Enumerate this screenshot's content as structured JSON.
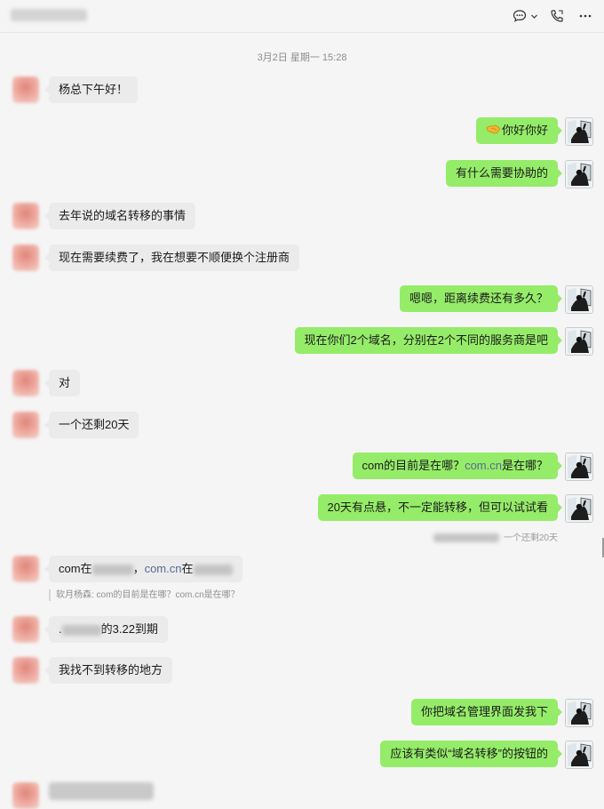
{
  "header": {
    "icons": [
      "chat-bubble-icon",
      "chevron-down-icon",
      "phone-icon",
      "more-icon"
    ]
  },
  "timestamp": "3月2日 星期一 15:28",
  "messages": [
    {
      "dir": "in",
      "text": "杨总下午好！"
    },
    {
      "dir": "out",
      "text": "你好你好",
      "emoji": "handshake-icon"
    },
    {
      "dir": "out",
      "text": "有什么需要协助的"
    },
    {
      "dir": "in",
      "text": "去年说的域名转移的事情"
    },
    {
      "dir": "in",
      "text": "现在需要续费了，我在想要不顺便换个注册商"
    },
    {
      "dir": "out",
      "text": "嗯嗯，距离续费还有多久？"
    },
    {
      "dir": "out",
      "text": "现在你们2个域名，分别在2个不同的服务商是吧"
    },
    {
      "dir": "in",
      "text": "对"
    },
    {
      "dir": "in",
      "text": "一个还剩20天"
    },
    {
      "dir": "out",
      "text_a": "com的目前是在哪？",
      "link": "com.cn",
      "text_b": "是在哪？"
    },
    {
      "dir": "out",
      "text": "20天有点悬，不一定能转移，但可以试试看",
      "quote": "一个还剩20天"
    },
    {
      "dir": "in",
      "text_a": "com在",
      "sep": "，",
      "link": "com.cn",
      "text_b": "在",
      "quote": "软月杨森: com的目前是在哪？com.cn是在哪？"
    },
    {
      "dir": "in",
      "text_a": ".",
      "text_b": "的3.22到期"
    },
    {
      "dir": "in",
      "text": "我找不到转移的地方"
    },
    {
      "dir": "out",
      "text": "你把域名管理界面发我下"
    },
    {
      "dir": "out",
      "text": "应该有类似“域名转移”的按钮的"
    }
  ]
}
